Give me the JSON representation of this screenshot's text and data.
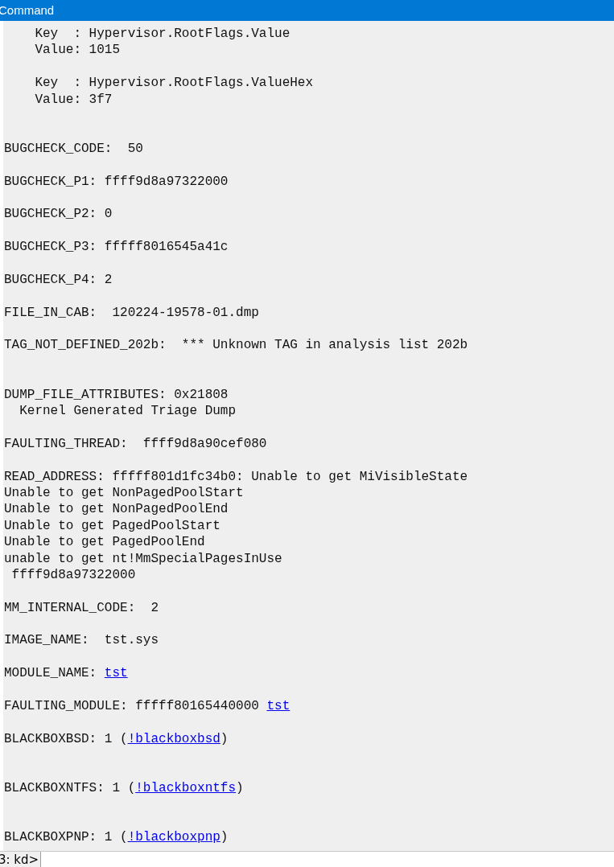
{
  "window": {
    "title": "Command"
  },
  "output": [
    {
      "kind": "text",
      "parts": [
        {
          "text": "    Key  : Hypervisor.RootFlags.Value"
        }
      ]
    },
    {
      "kind": "text",
      "parts": [
        {
          "text": "    Value: 1015"
        }
      ]
    },
    {
      "kind": "blank"
    },
    {
      "kind": "text",
      "parts": [
        {
          "text": "    Key  : Hypervisor.RootFlags.ValueHex"
        }
      ]
    },
    {
      "kind": "text",
      "parts": [
        {
          "text": "    Value: 3f7"
        }
      ]
    },
    {
      "kind": "blank"
    },
    {
      "kind": "blank"
    },
    {
      "kind": "text",
      "parts": [
        {
          "text": "BUGCHECK_CODE:  50"
        }
      ]
    },
    {
      "kind": "blank"
    },
    {
      "kind": "text",
      "parts": [
        {
          "text": "BUGCHECK_P1: ffff9d8a97322000"
        }
      ]
    },
    {
      "kind": "blank"
    },
    {
      "kind": "text",
      "parts": [
        {
          "text": "BUGCHECK_P2: 0"
        }
      ]
    },
    {
      "kind": "blank"
    },
    {
      "kind": "text",
      "parts": [
        {
          "text": "BUGCHECK_P3: fffff8016545a41c"
        }
      ]
    },
    {
      "kind": "blank"
    },
    {
      "kind": "text",
      "parts": [
        {
          "text": "BUGCHECK_P4: 2"
        }
      ]
    },
    {
      "kind": "blank"
    },
    {
      "kind": "text",
      "parts": [
        {
          "text": "FILE_IN_CAB:  120224-19578-01.dmp"
        }
      ]
    },
    {
      "kind": "blank"
    },
    {
      "kind": "text",
      "parts": [
        {
          "text": "TAG_NOT_DEFINED_202b:  *** Unknown TAG in analysis list 202b"
        }
      ]
    },
    {
      "kind": "blank"
    },
    {
      "kind": "blank"
    },
    {
      "kind": "text",
      "parts": [
        {
          "text": "DUMP_FILE_ATTRIBUTES: 0x21808"
        }
      ]
    },
    {
      "kind": "text",
      "parts": [
        {
          "text": "  Kernel Generated Triage Dump"
        }
      ]
    },
    {
      "kind": "blank"
    },
    {
      "kind": "text",
      "parts": [
        {
          "text": "FAULTING_THREAD:  ffff9d8a90cef080"
        }
      ]
    },
    {
      "kind": "blank"
    },
    {
      "kind": "text",
      "parts": [
        {
          "text": "READ_ADDRESS: fffff801d1fc34b0: Unable to get MiVisibleState"
        }
      ]
    },
    {
      "kind": "text",
      "parts": [
        {
          "text": "Unable to get NonPagedPoolStart"
        }
      ]
    },
    {
      "kind": "text",
      "parts": [
        {
          "text": "Unable to get NonPagedPoolEnd"
        }
      ]
    },
    {
      "kind": "text",
      "parts": [
        {
          "text": "Unable to get PagedPoolStart"
        }
      ]
    },
    {
      "kind": "text",
      "parts": [
        {
          "text": "Unable to get PagedPoolEnd"
        }
      ]
    },
    {
      "kind": "text",
      "parts": [
        {
          "text": "unable to get nt!MmSpecialPagesInUse"
        }
      ]
    },
    {
      "kind": "text",
      "parts": [
        {
          "text": " ffff9d8a97322000"
        }
      ]
    },
    {
      "kind": "blank"
    },
    {
      "kind": "text",
      "parts": [
        {
          "text": "MM_INTERNAL_CODE:  2"
        }
      ]
    },
    {
      "kind": "blank"
    },
    {
      "kind": "text",
      "parts": [
        {
          "text": "IMAGE_NAME:  tst.sys"
        }
      ]
    },
    {
      "kind": "blank"
    },
    {
      "kind": "text",
      "parts": [
        {
          "text": "MODULE_NAME: "
        },
        {
          "text": "tst",
          "link": true
        }
      ]
    },
    {
      "kind": "blank"
    },
    {
      "kind": "text",
      "parts": [
        {
          "text": "FAULTING_MODULE: fffff80165440000 "
        },
        {
          "text": "tst",
          "link": true
        }
      ]
    },
    {
      "kind": "blank"
    },
    {
      "kind": "text",
      "parts": [
        {
          "text": "BLACKBOXBSD: 1 ("
        },
        {
          "text": "!blackboxbsd",
          "link": true
        },
        {
          "text": ")"
        }
      ]
    },
    {
      "kind": "blank"
    },
    {
      "kind": "blank"
    },
    {
      "kind": "text",
      "parts": [
        {
          "text": "BLACKBOXNTFS: 1 ("
        },
        {
          "text": "!blackboxntfs",
          "link": true
        },
        {
          "text": ")"
        }
      ]
    },
    {
      "kind": "blank"
    },
    {
      "kind": "blank"
    },
    {
      "kind": "text",
      "parts": [
        {
          "text": "BLACKBOXPNP: 1 ("
        },
        {
          "text": "!blackboxpnp",
          "link": true
        },
        {
          "text": ")"
        }
      ]
    }
  ],
  "prompt": {
    "label": "3: kd>"
  }
}
